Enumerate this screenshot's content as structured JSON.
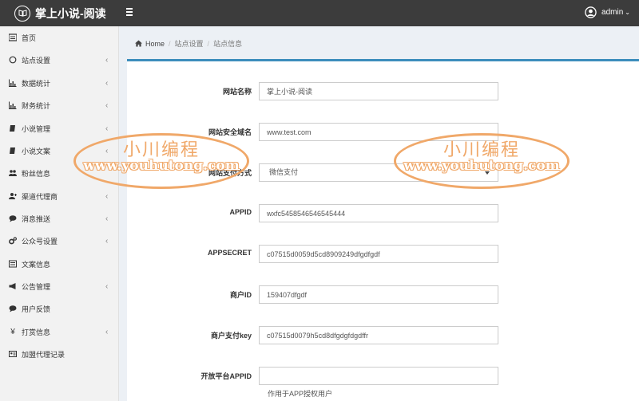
{
  "app": {
    "brand": "掌上小说-阅读",
    "user": "admin"
  },
  "sidebar": {
    "items": [
      {
        "label": "首页",
        "icon": "dashboard-icon",
        "has_submenu": false
      },
      {
        "label": "站点设置",
        "icon": "circle-icon",
        "has_submenu": true
      },
      {
        "label": "数据统计",
        "icon": "bar-chart-icon",
        "has_submenu": true
      },
      {
        "label": "财务统计",
        "icon": "bar-chart-icon",
        "has_submenu": true
      },
      {
        "label": "小说管理",
        "icon": "book-icon",
        "has_submenu": true
      },
      {
        "label": "小说文案",
        "icon": "book-icon",
        "has_submenu": true
      },
      {
        "label": "粉丝信息",
        "icon": "users-icon",
        "has_submenu": false
      },
      {
        "label": "渠道代理商",
        "icon": "user-plus-icon",
        "has_submenu": true
      },
      {
        "label": "消息推送",
        "icon": "comment-icon",
        "has_submenu": true
      },
      {
        "label": "公众号设置",
        "icon": "cogs-icon",
        "has_submenu": true
      },
      {
        "label": "文案信息",
        "icon": "list-icon",
        "has_submenu": false
      },
      {
        "label": "公告管理",
        "icon": "bullhorn-icon",
        "has_submenu": true
      },
      {
        "label": "用户反馈",
        "icon": "comment-icon",
        "has_submenu": false
      },
      {
        "label": "打赏信息",
        "icon": "yen-icon",
        "has_submenu": true
      },
      {
        "label": "加盟代理记录",
        "icon": "id-card-icon",
        "has_submenu": false
      }
    ]
  },
  "breadcrumb": [
    "Home",
    "站点设置",
    "站点信息"
  ],
  "form": {
    "site_name": {
      "label": "网站名称",
      "value": "掌上小说-阅读"
    },
    "safe_domain": {
      "label": "网站安全域名",
      "value": "www.test.com"
    },
    "pay_method": {
      "label": "网站支付方式",
      "value": "微信支付"
    },
    "appid": {
      "label": "APPID",
      "value": "wxfc5458546546545444"
    },
    "appsecret": {
      "label": "APPSECRET",
      "value": "c07515d0059d5cd8909249dfgdfgdf"
    },
    "mch_id": {
      "label": "商户ID",
      "value": "159407dfgdf"
    },
    "pay_key": {
      "label": "商户支付key",
      "value": "c07515d0079h5cd8dfgdgfdgdffr"
    },
    "open_appid": {
      "label": "开放平台APPID",
      "value": "",
      "help": "作用于APP授权用户"
    }
  },
  "watermark": {
    "top": "小川编程",
    "bottom": "www.youhutong.com"
  },
  "colors": {
    "topbar": "#3c3c3c",
    "accent": "#3c8dbc",
    "watermark": "#f0a869"
  }
}
